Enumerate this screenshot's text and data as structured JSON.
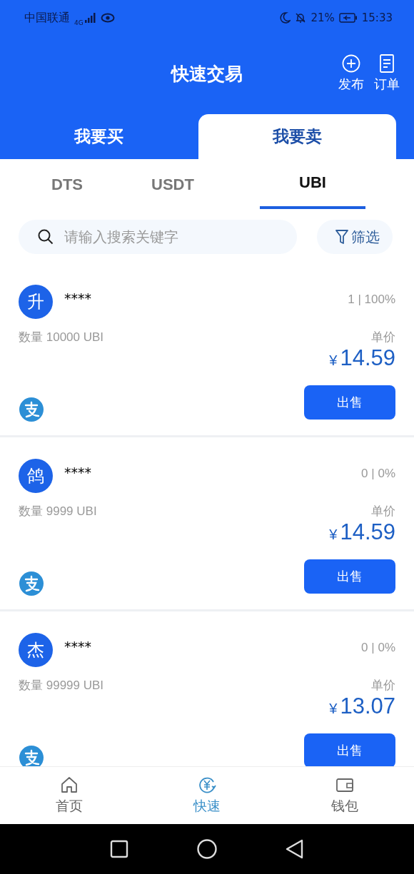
{
  "status_bar": {
    "carrier": "中国联通",
    "network": "4G",
    "battery": "21%",
    "time": "15:33"
  },
  "header": {
    "title": "快速交易",
    "actions": [
      {
        "kind": "add",
        "label": "发布"
      },
      {
        "kind": "orders",
        "label": "订单"
      }
    ]
  },
  "trade_tabs": [
    {
      "label": "我要买",
      "selected": false
    },
    {
      "label": "我要卖",
      "selected": true
    }
  ],
  "coin_tabs": [
    {
      "label": "DTS",
      "selected": false
    },
    {
      "label": "USDT",
      "selected": false
    },
    {
      "label": "UBI",
      "selected": true
    }
  ],
  "search": {
    "placeholder": "请输入搜索关键字"
  },
  "filter_button": {
    "label": "筛选"
  },
  "listings": [
    {
      "avatar": "升",
      "name": "****",
      "stats": "1 | 100%",
      "quantity": "数量 10000 UBI",
      "price_label": "单价",
      "currency": "¥",
      "price": "14.59",
      "action": "出售"
    },
    {
      "avatar": "鸽",
      "name": "****",
      "stats": "0 | 0%",
      "quantity": "数量 9999 UBI",
      "price_label": "单价",
      "currency": "¥",
      "price": "14.59",
      "action": "出售"
    },
    {
      "avatar": "杰",
      "name": "****",
      "stats": "0 | 0%",
      "quantity": "数量 99999 UBI",
      "price_label": "单价",
      "currency": "¥",
      "price": "13.07",
      "action": "出售"
    }
  ],
  "bottom_nav": [
    {
      "kind": "home",
      "label": "首页",
      "selected": false
    },
    {
      "kind": "exchange",
      "label": "快速",
      "selected": true
    },
    {
      "kind": "wallet",
      "label": "钱包",
      "selected": false
    }
  ]
}
